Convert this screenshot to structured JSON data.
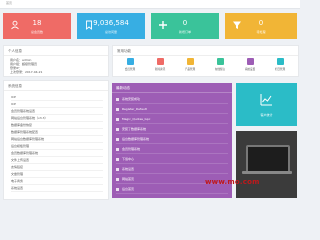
{
  "topbar": {
    "text": "首页"
  },
  "stats": [
    {
      "value": "18",
      "label": "总会员数",
      "icon": "user-icon"
    },
    {
      "value": "9,036,584",
      "label": "总访问量",
      "icon": "bookmark-icon"
    },
    {
      "value": "0",
      "label": "新增订单",
      "icon": "plus-icon"
    },
    {
      "value": "0",
      "label": "待处理",
      "icon": "funnel-icon"
    }
  ],
  "info_panel": {
    "title": "个人信息",
    "lines": [
      "用户名：admin",
      "用户组：超级管理员",
      "登录IP：",
      "上次登录：2017-04-21"
    ]
  },
  "quick_panel": {
    "title": "常用功能",
    "items": [
      {
        "label": "会员管理",
        "color": "#37aee3"
      },
      {
        "label": "新闻资讯",
        "color": "#ef6b66"
      },
      {
        "label": "产品管理",
        "color": "#f1b536"
      },
      {
        "label": "在线留言",
        "color": "#3ac39a"
      },
      {
        "label": "系统设置",
        "color": "#9d5db5"
      },
      {
        "label": "栏目管理",
        "color": "#2bbcc7"
      }
    ]
  },
  "list_panel": {
    "title": "系统信息",
    "rows": [
      "ICP",
      "ICP",
      "会员管理系统设置",
      "网站后台管理系统（v3.3）",
      "数据库备份恢复",
      "数据库管理系统配置",
      "网站后台数据库管理系统",
      "后台模板管理",
      "会员数据库管理系统",
      "文件上传设置",
      "友情链接",
      "文章管理",
      "电子商务",
      "系统设置"
    ]
  },
  "purple_panel": {
    "title": "最新动态",
    "rows": [
      {
        "label": "系统安装成功",
        "date": ""
      },
      {
        "label": "Register_Default",
        "date": ""
      },
      {
        "label": "Magic_Quotes_Gpc",
        "date": ""
      },
      {
        "label": "安装了数据库系统",
        "date": ""
      },
      {
        "label": "后台数据库管理系统",
        "date": ""
      },
      {
        "label": "会员管理系统",
        "date": ""
      },
      {
        "label": "下载中心",
        "date": ""
      },
      {
        "label": "系统设置",
        "date": ""
      },
      {
        "label": "网站首页",
        "date": ""
      },
      {
        "label": "后台首页",
        "date": ""
      }
    ]
  },
  "teal_panel": {
    "label": "客户统计"
  },
  "watermark": "www.mo.com"
}
